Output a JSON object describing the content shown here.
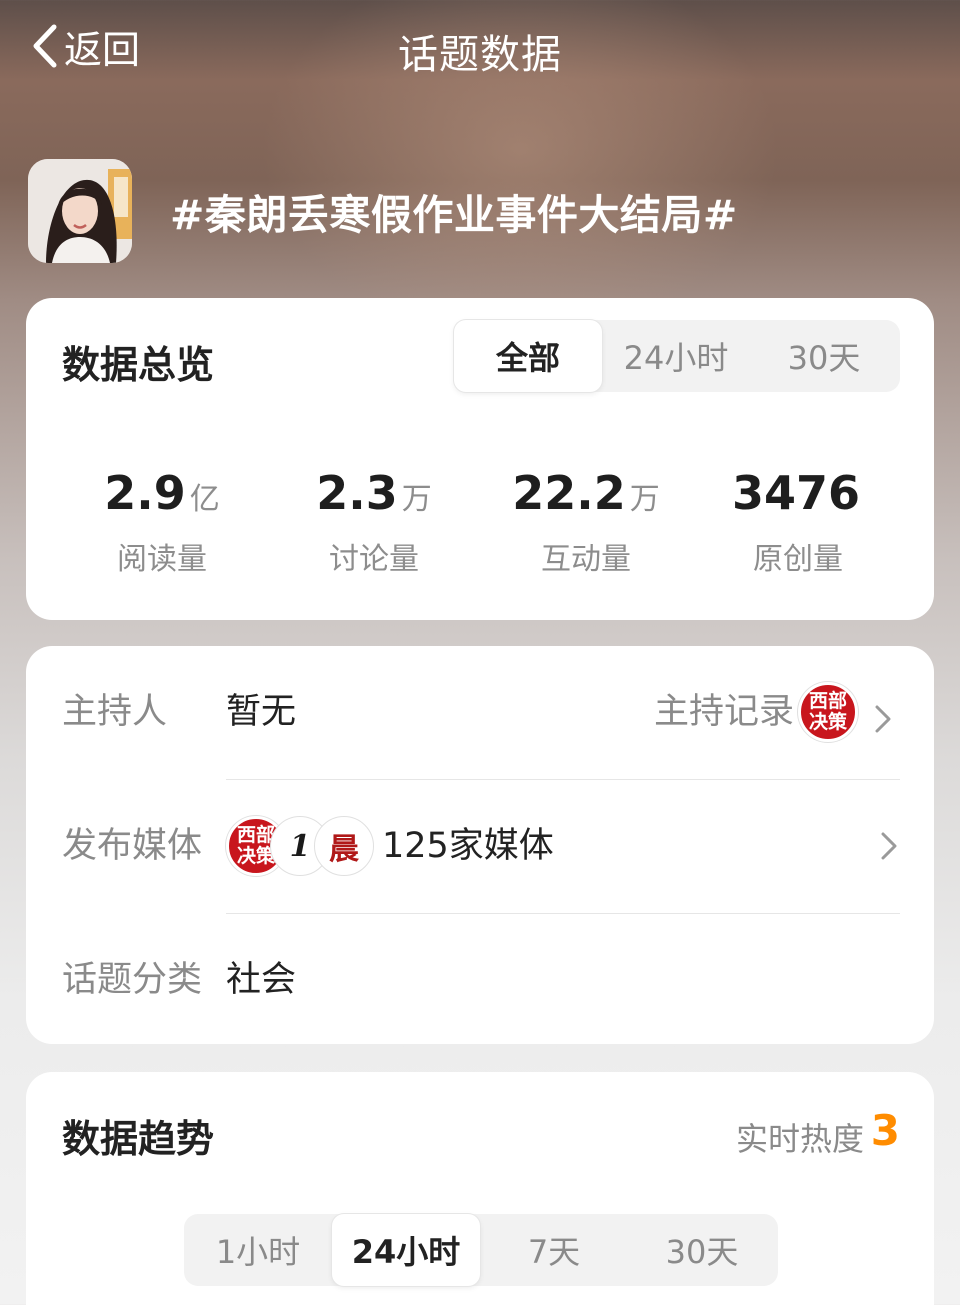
{
  "topbar": {
    "back_label": "返回",
    "title": "话题数据"
  },
  "topic": {
    "title": "#秦朗丢寒假作业事件大结局#"
  },
  "overview": {
    "heading": "数据总览",
    "ranges": [
      "全部",
      "24小时",
      "30天"
    ],
    "active_range": "全部",
    "stats": [
      {
        "value": "2.9",
        "unit": "亿",
        "label": "阅读量"
      },
      {
        "value": "2.3",
        "unit": "万",
        "label": "讨论量"
      },
      {
        "value": "22.2",
        "unit": "万",
        "label": "互动量"
      },
      {
        "value": "3476",
        "unit": "",
        "label": "原创量"
      }
    ]
  },
  "info": {
    "host_label": "主持人",
    "host_value": "暂无",
    "host_record_link": "主持记录",
    "host_record_logo": [
      "西部",
      "决策"
    ],
    "media_label": "发布媒体",
    "media_logos": [
      {
        "kind": "red",
        "lines": [
          "西部",
          "决策"
        ]
      },
      {
        "kind": "mono",
        "glyph": "1"
      },
      {
        "kind": "mono",
        "glyph": "晨"
      }
    ],
    "media_value": "125家媒体",
    "category_label": "话题分类",
    "category_value": "社会"
  },
  "trend": {
    "heading": "数据趋势",
    "heat_label": "实时热度",
    "heat_value": "3",
    "heat_color": "#ff8c00",
    "ranges": [
      "1小时",
      "24小时",
      "7天",
      "30天"
    ],
    "active_range": "24小时"
  }
}
